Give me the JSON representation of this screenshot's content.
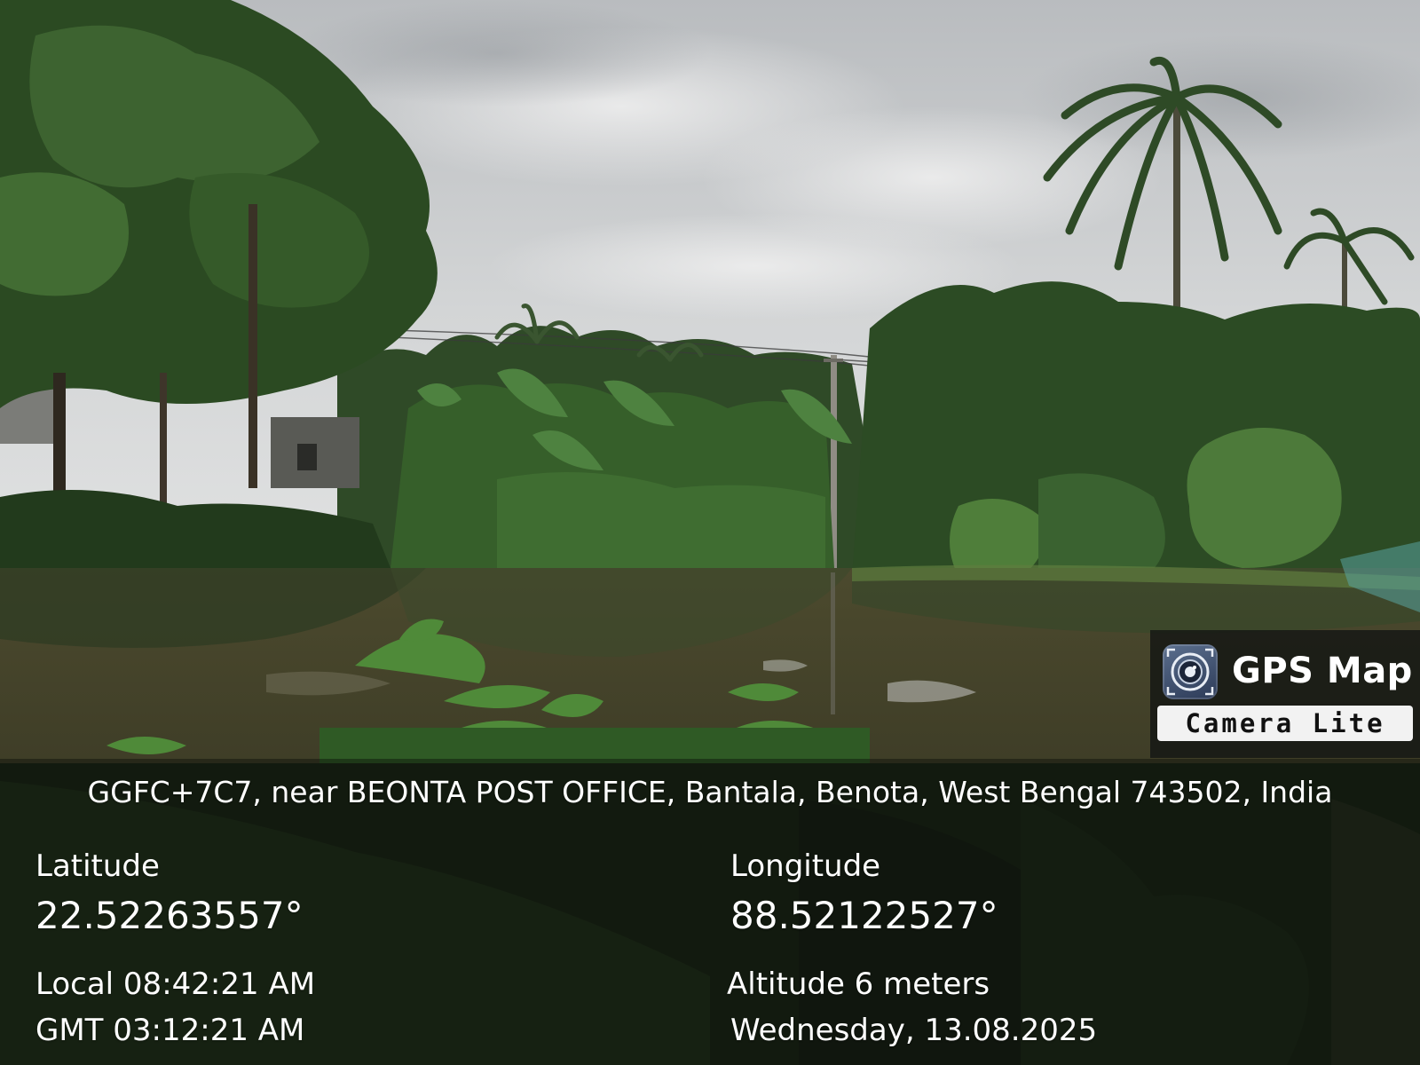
{
  "badge": {
    "icon": "camera-lens-icon",
    "title": "GPS Map",
    "subtitle": "Camera Lite"
  },
  "location": {
    "address": "GGFC+7C7, near BEONTA POST OFFICE, Bantala, Benota, West Bengal 743502, India",
    "latitude_label": "Latitude",
    "latitude_value": "22.52263557°",
    "longitude_label": "Longitude",
    "longitude_value": "88.52122527°",
    "local_time": "Local 08:42:21 AM",
    "gmt_time": "GMT 03:12:21 AM",
    "altitude": "Altitude 6 meters",
    "date": "Wednesday, 13.08.2025"
  },
  "colors": {
    "sky": "#c9ccce",
    "foliage_dark": "#1f3a1a",
    "foliage_light": "#4f7a36",
    "pond_water": "#3e3a24",
    "overlay_text": "#ffffff"
  }
}
